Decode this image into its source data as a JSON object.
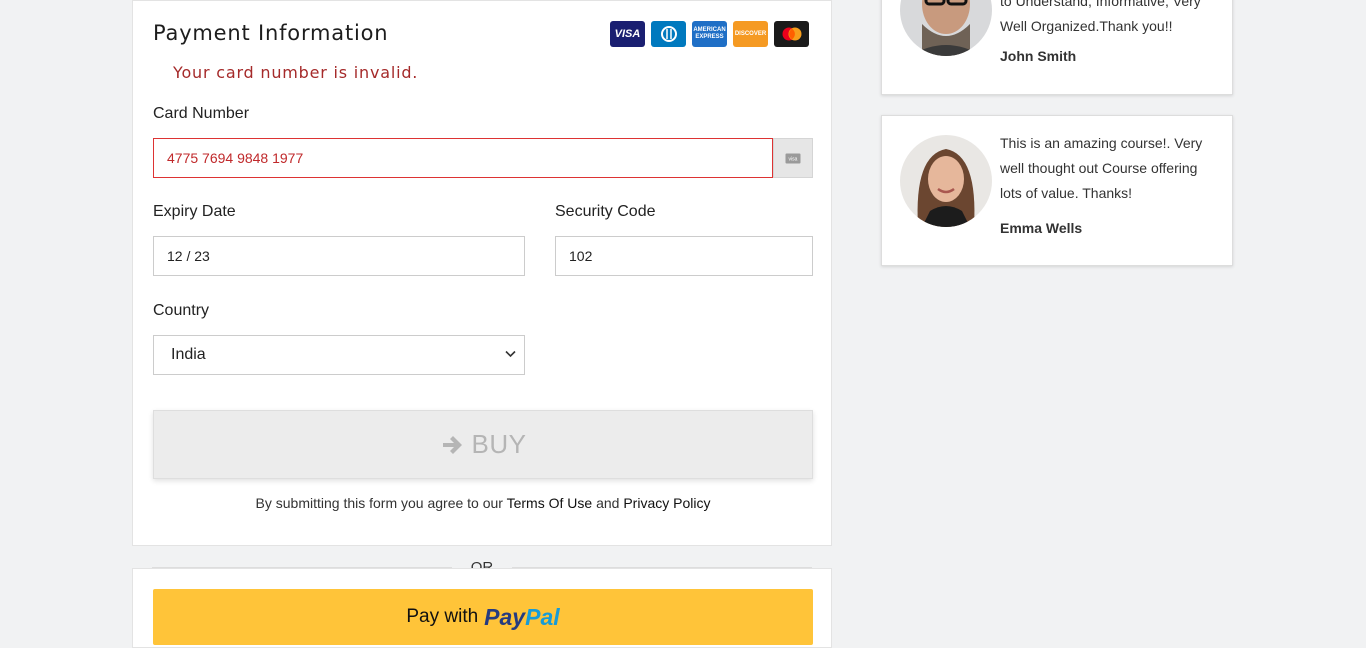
{
  "payment": {
    "title": "Payment Information",
    "card_brands": [
      "visa-logo",
      "diners-logo",
      "amex-logo",
      "discover-logo",
      "mastercard-logo"
    ],
    "error": "Your card number is invalid.",
    "card_number_label": "Card Number",
    "card_number_value": "4775 7694 9848 1977",
    "expiry_label": "Expiry Date",
    "expiry_value": "12 / 23",
    "security_label": "Security Code",
    "security_value": "102",
    "country_label": "Country",
    "country_value": "India",
    "buy_label": "BUY",
    "terms_prefix": "By submitting this form you agree to our",
    "terms_link": "Terms Of Use",
    "terms_and": "and",
    "privacy_link": "Privacy Policy"
  },
  "or_label": "OR",
  "paypal": {
    "prefix": "Pay with",
    "brand_pay": "Pay",
    "brand_pal": "Pal"
  },
  "testimonials": [
    {
      "quote_visible": "to Understand, Informative, Very Well Organized.Thank you!!",
      "author": "John Smith"
    },
    {
      "quote": "This is an amazing course!. Very well thought out Course offering lots of value. Thanks!",
      "author": "Emma Wells"
    }
  ],
  "colors": {
    "error": "#a52a2a",
    "paypal_yellow": "#ffc439",
    "paypal_dark_blue": "#253b80",
    "paypal_light_blue": "#179bd7"
  }
}
